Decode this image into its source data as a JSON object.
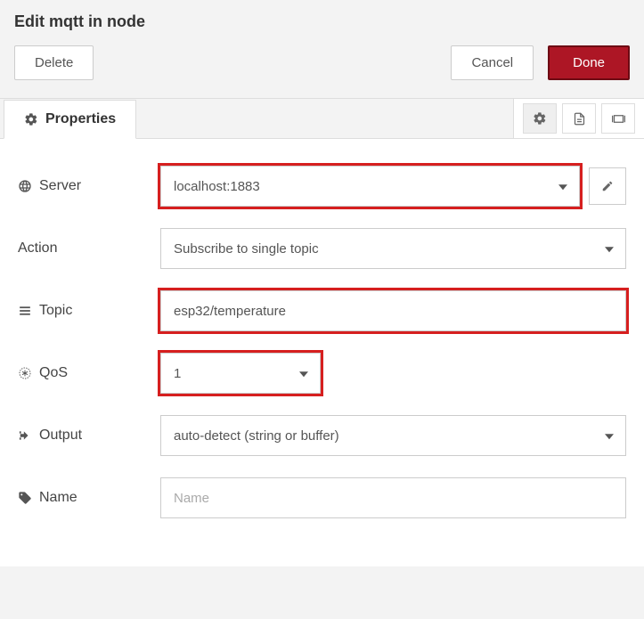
{
  "header": {
    "title": "Edit mqtt in node",
    "delete_label": "Delete",
    "cancel_label": "Cancel",
    "done_label": "Done"
  },
  "tabs": {
    "properties_label": "Properties"
  },
  "form": {
    "server": {
      "label": "Server",
      "value": "localhost:1883"
    },
    "action": {
      "label": "Action",
      "value": "Subscribe to single topic"
    },
    "topic": {
      "label": "Topic",
      "value": "esp32/temperature"
    },
    "qos": {
      "label": "QoS",
      "value": "1"
    },
    "output": {
      "label": "Output",
      "value": "auto-detect (string or buffer)"
    },
    "name": {
      "label": "Name",
      "value": "",
      "placeholder": "Name"
    }
  }
}
